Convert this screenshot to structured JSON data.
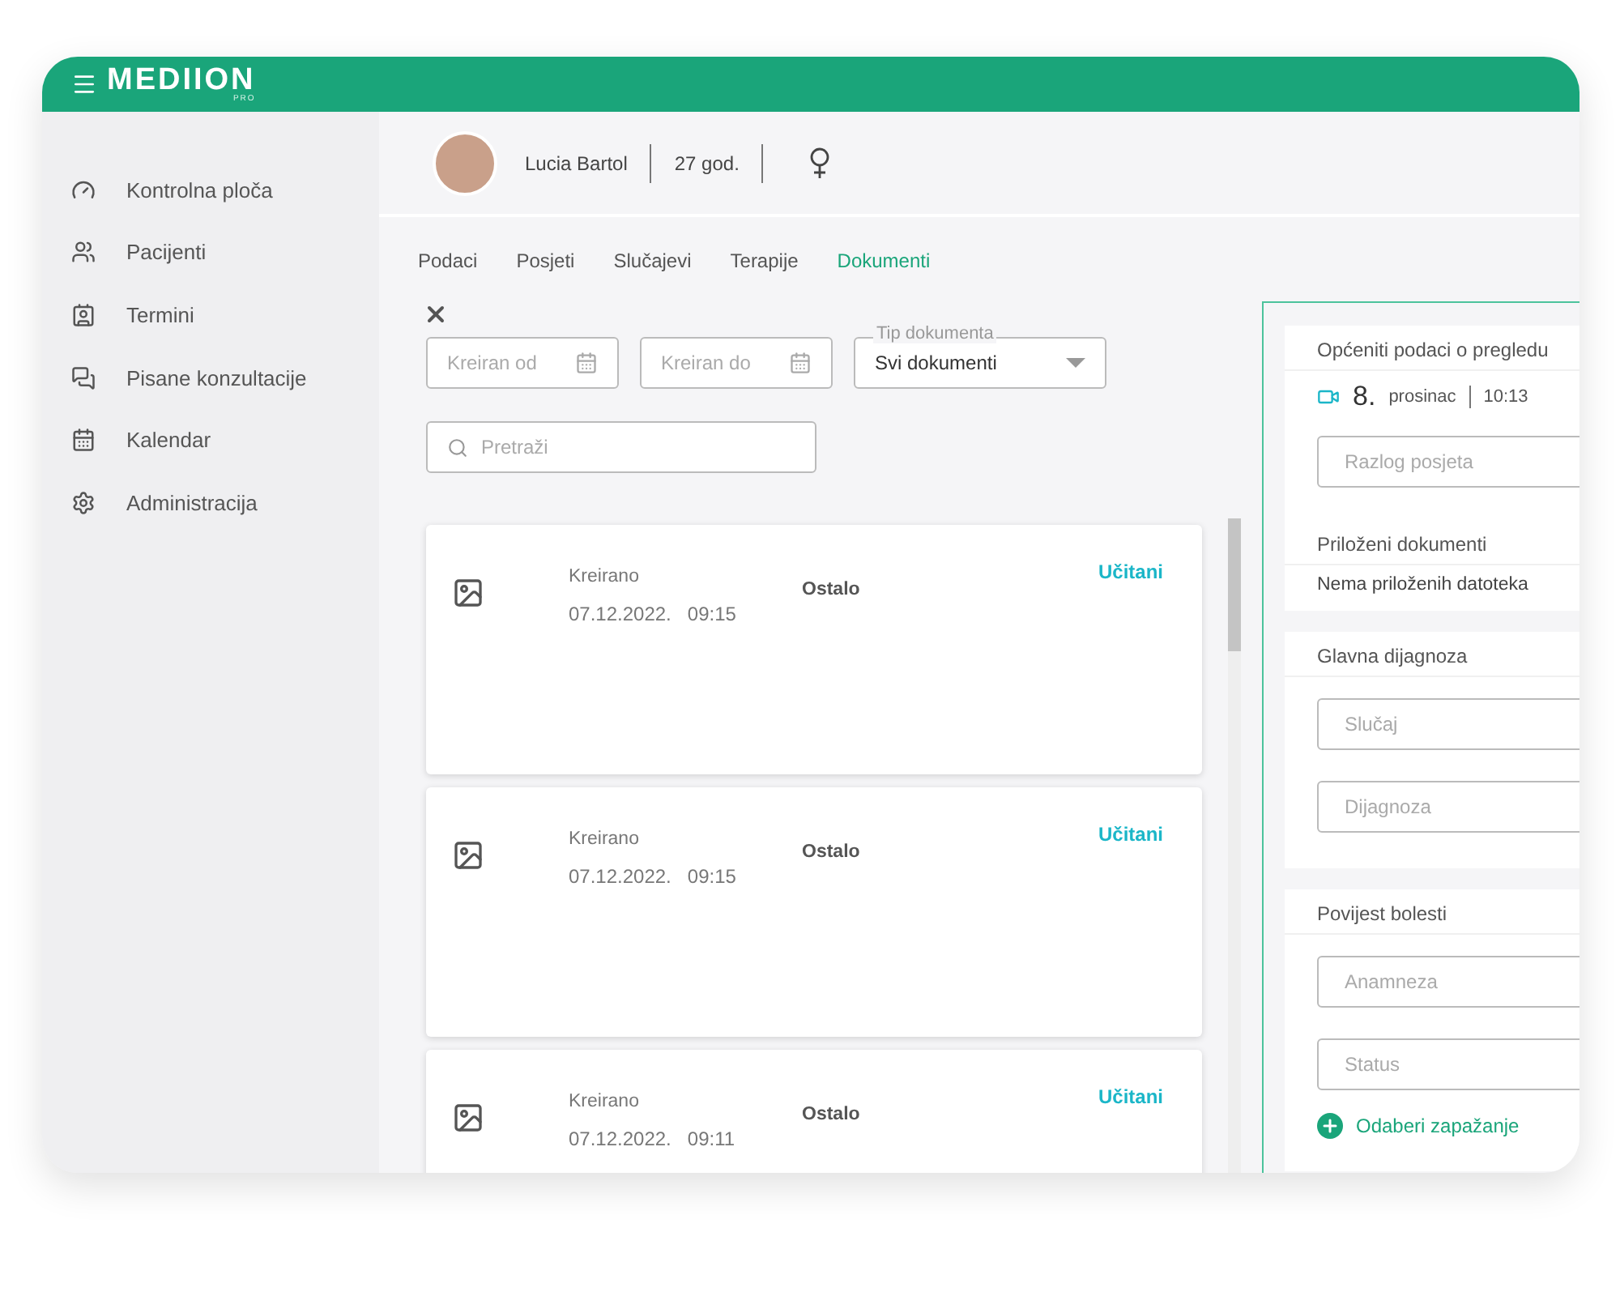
{
  "logo": {
    "name": "MEDIION",
    "sub": "PRO"
  },
  "sidebar": {
    "items": [
      {
        "label": "Kontrolna ploča",
        "selected": false
      },
      {
        "label": "Pacijenti",
        "selected": false
      },
      {
        "label": "Termini",
        "selected": false
      },
      {
        "label": "Pisane konzultacije",
        "selected": false
      },
      {
        "label": "Kalendar",
        "selected": false
      },
      {
        "label": "Administracija",
        "selected": false
      }
    ]
  },
  "patient": {
    "name": "Lucia Bartol",
    "age": "27 god."
  },
  "tabs": [
    {
      "label": "Podaci",
      "selected": false
    },
    {
      "label": "Posjeti",
      "selected": false
    },
    {
      "label": "Slučajevi",
      "selected": false
    },
    {
      "label": "Terapije",
      "selected": false
    },
    {
      "label": "Dokumenti",
      "selected": true
    }
  ],
  "filters": {
    "date_from": {
      "placeholder": "Kreiran od"
    },
    "date_to": {
      "placeholder": "Kreiran do"
    },
    "document_type": {
      "label": "Tip dokumenta",
      "value": "Svi dokumenti"
    },
    "search": {
      "placeholder": "Pretraži"
    }
  },
  "documents": [
    {
      "created_label": "Kreirano",
      "date": "07.12.2022.",
      "time": "09:15",
      "type": "Ostalo",
      "status": "Učitani"
    },
    {
      "created_label": "Kreirano",
      "date": "07.12.2022.",
      "time": "09:15",
      "type": "Ostalo",
      "status": "Učitani"
    },
    {
      "created_label": "Kreirano",
      "date": "07.12.2022.",
      "time": "09:11",
      "type": "Ostalo",
      "status": "Učitani"
    }
  ],
  "visit": {
    "general": {
      "title": "Općeniti podaci o pregledu",
      "day": "8.",
      "month": "prosinac",
      "time": "10:13",
      "reason": {
        "placeholder": "Razlog posjeta"
      }
    },
    "attachments": {
      "title": "Priloženi dokumenti",
      "empty": "Nema priloženih datoteka"
    },
    "diagnosis": {
      "title": "Glavna dijagnoza",
      "fields": [
        {
          "placeholder": "Slučaj"
        },
        {
          "placeholder": "Dijagnoza"
        }
      ]
    },
    "history": {
      "title": "Povijest bolesti",
      "fields": [
        {
          "placeholder": "Anamneza"
        },
        {
          "placeholder": "Status"
        }
      ],
      "add_label": "Odaberi zapažanje"
    }
  }
}
